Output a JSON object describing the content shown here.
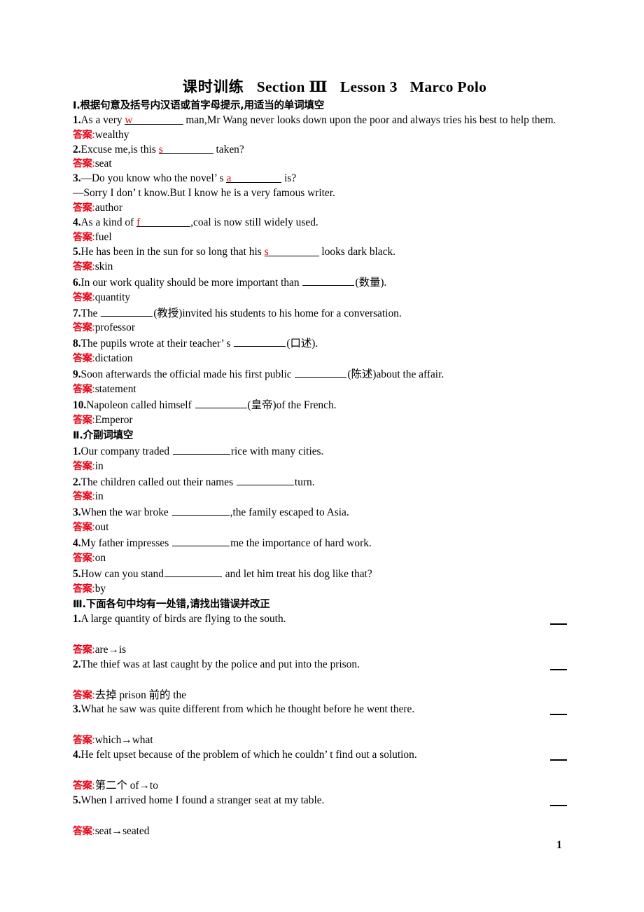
{
  "title": {
    "cn": "课时训练",
    "section": "Section Ⅲ",
    "lesson": "Lesson 3",
    "topic": "Marco Polo"
  },
  "page_number": "1",
  "answer_label": "答案",
  "colon": ":",
  "sections": [
    {
      "heading": "Ⅰ.根据句意及括号内汉语或首字母提示,用适当的单词填空",
      "items": [
        {
          "num": "1.",
          "pre": "As a very ",
          "hint": "w",
          "post": " man,Mr Wang never looks down upon the poor and always tries his best to help them.",
          "answer": "wealthy"
        },
        {
          "num": "2.",
          "pre": "Excuse me,is this ",
          "hint": "s",
          "post": " taken?",
          "answer": "seat"
        },
        {
          "num": "3.",
          "pre": "—Do you know who the novel’ s ",
          "hint": "a",
          "post": " is?",
          "line2": "—Sorry I don’ t know.But I know he is a very famous writer.",
          "answer": "author"
        },
        {
          "num": "4.",
          "pre": "As a kind of ",
          "hint": "f",
          "post": ",coal is now still widely used.",
          "answer": "fuel"
        },
        {
          "num": "5.",
          "pre": "He has been in the sun for so long that his ",
          "hint": "s",
          "post": " looks dark black.",
          "answer": "skin"
        },
        {
          "num": "6.",
          "pre": "In our work quality should be more important than ",
          "hint": "",
          "post": "(数量).",
          "answer": "quantity"
        },
        {
          "num": "7.",
          "pre": "The ",
          "hint": "",
          "post": "(教授)invited his students to his home for a conversation.",
          "answer": "professor"
        },
        {
          "num": "8.",
          "pre": "The pupils wrote at their teacher’ s ",
          "hint": "",
          "post": "(口述).",
          "answer": "dictation"
        },
        {
          "num": "9.",
          "pre": "Soon afterwards the official made his first public ",
          "hint": "",
          "post": "(陈述)about the affair.",
          "answer": "statement"
        },
        {
          "num": "10.",
          "pre": "Napoleon called himself ",
          "hint": "",
          "post": "(皇帝)of the French.",
          "answer": "Emperor"
        }
      ]
    },
    {
      "heading": "Ⅱ.介副词填空",
      "items": [
        {
          "num": "1.",
          "pre": "Our company traded ",
          "hint": "",
          "post": "rice with many cities.",
          "answer": "in"
        },
        {
          "num": "2.",
          "pre": "The children called out their names ",
          "hint": "",
          "post": "turn.",
          "answer": "in"
        },
        {
          "num": "3.",
          "pre": "When the war broke ",
          "hint": "",
          "post": ",the family escaped to Asia.",
          "answer": "out"
        },
        {
          "num": "4.",
          "pre": "My father impresses ",
          "hint": "",
          "post": "me the importance of hard work.",
          "answer": "on"
        },
        {
          "num": "5.",
          "pre": "How can you stand",
          "hint": "",
          "post": " and let him treat his dog like that?",
          "answer": "by"
        }
      ]
    },
    {
      "heading": "Ⅲ.下面各句中均有一处错,请找出错误并改正",
      "items": [
        {
          "num": "1.",
          "sentence": "A large quantity of birds are flying to the south.",
          "answer": "are→is"
        },
        {
          "num": "2.",
          "sentence": "The thief was at last caught by the police and put into the prison.",
          "answer": "去掉 prison 前的 the"
        },
        {
          "num": "3.",
          "sentence": "What he saw was quite different from which he thought before he went there.",
          "answer": "which→what"
        },
        {
          "num": "4.",
          "sentence": "He felt upset because of the problem of which he couldn’ t find out a solution.",
          "answer": "第二个 of→to"
        },
        {
          "num": "5.",
          "sentence": "When I arrived home I found a stranger seat at my table.",
          "answer": "seat→seated"
        }
      ]
    }
  ]
}
